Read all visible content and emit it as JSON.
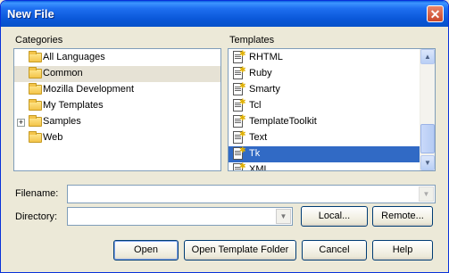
{
  "window": {
    "title": "New File",
    "close_glyph": "✕"
  },
  "categories": {
    "label": "Categories",
    "items": [
      {
        "label": "All Languages",
        "selected": false,
        "expandable": false
      },
      {
        "label": "Common",
        "selected": true,
        "expandable": false
      },
      {
        "label": "Mozilla Development",
        "selected": false,
        "expandable": false
      },
      {
        "label": "My Templates",
        "selected": false,
        "expandable": false
      },
      {
        "label": "Samples",
        "selected": false,
        "expandable": true
      },
      {
        "label": "Web",
        "selected": false,
        "expandable": false
      }
    ]
  },
  "templates": {
    "label": "Templates",
    "items": [
      {
        "label": "RHTML",
        "selected": false
      },
      {
        "label": "Ruby",
        "selected": false
      },
      {
        "label": "Smarty",
        "selected": false
      },
      {
        "label": "Tcl",
        "selected": false
      },
      {
        "label": "TemplateToolkit",
        "selected": false
      },
      {
        "label": "Text",
        "selected": false
      },
      {
        "label": "Tk",
        "selected": true
      },
      {
        "label": "XML",
        "selected": false
      }
    ]
  },
  "filename": {
    "label": "Filename:",
    "value": ""
  },
  "directory": {
    "label": "Directory:",
    "value": ""
  },
  "buttons": {
    "local": "Local...",
    "remote": "Remote...",
    "open": "Open",
    "open_template_folder": "Open Template Folder",
    "cancel": "Cancel",
    "help": "Help"
  },
  "colors": {
    "title_bar": "#0a57d8",
    "selection": "#316ac5",
    "dialog_bg": "#ece9d8"
  }
}
